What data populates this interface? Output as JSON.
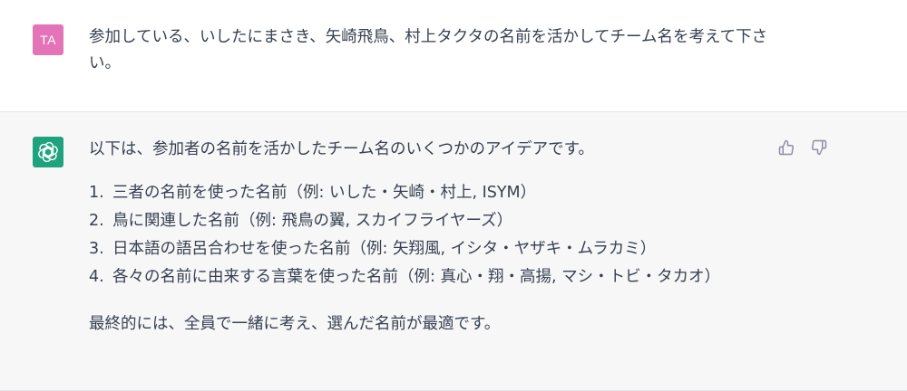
{
  "user": {
    "avatar_initials": "TA",
    "avatar_color": "#e374b7",
    "message": "参加している、いしたにまさき、矢崎飛鳥、村上タクタの名前を活かしてチーム名を考えて下さい。"
  },
  "assistant": {
    "avatar_icon": "openai-logo-icon",
    "avatar_color": "#1fa37f",
    "intro": "以下は、参加者の名前を活かしたチーム名のいくつかのアイデアです。",
    "ideas": [
      {
        "num": "1.",
        "text": "三者の名前を使った名前（例: いした・矢崎・村上, ISYM）"
      },
      {
        "num": "2.",
        "text": "鳥に関連した名前（例: 飛鳥の翼, スカイフライヤーズ）"
      },
      {
        "num": "3.",
        "text": "日本語の語呂合わせを使った名前（例: 矢翔風, イシタ・ヤザキ・ムラカミ）"
      },
      {
        "num": "4.",
        "text": "各々の名前に由来する言葉を使った名前（例: 真心・翔・高揚, マシ・トビ・タカオ）"
      }
    ],
    "closing": "最終的には、全員で一緒に考え、選んだ名前が最適です。",
    "feedback": {
      "thumbs_up_icon": "thumbs-up-icon",
      "thumbs_down_icon": "thumbs-down-icon"
    }
  }
}
